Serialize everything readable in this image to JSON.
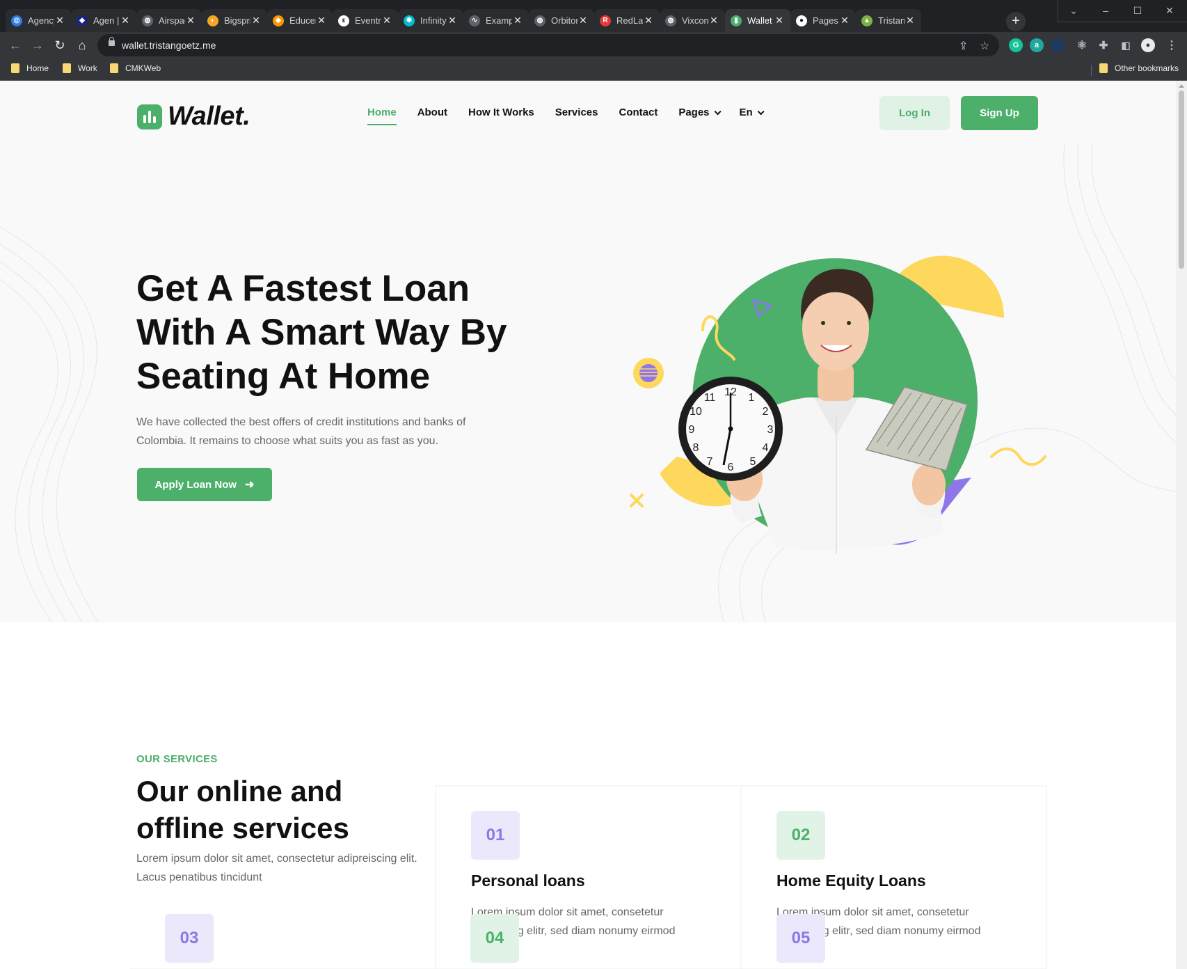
{
  "browser": {
    "tabs": [
      {
        "label": "Agency",
        "color": "#2b7de9",
        "glyph": "◎"
      },
      {
        "label": "Agen |",
        "color": "#1a237e",
        "glyph": "◆"
      },
      {
        "label": "Airspace",
        "color": "#5f6368",
        "glyph": "◍"
      },
      {
        "label": "Bigspring",
        "color": "#f5a623",
        "glyph": "◐"
      },
      {
        "label": "Educenter",
        "color": "#ff9800",
        "glyph": "◆"
      },
      {
        "label": "Eventre",
        "color": "#ffffff",
        "glyph": "ε"
      },
      {
        "label": "Infinity",
        "color": "#00bcd4",
        "glyph": "✱"
      },
      {
        "label": "Example",
        "color": "#5f6368",
        "glyph": "∿"
      },
      {
        "label": "Orbiton",
        "color": "#5f6368",
        "glyph": "◍"
      },
      {
        "label": "RedLab",
        "color": "#e53935",
        "glyph": "R"
      },
      {
        "label": "Vixcon",
        "color": "#5f6368",
        "glyph": "◍"
      },
      {
        "label": "Wallet",
        "color": "#4caf6a",
        "glyph": "▮"
      },
      {
        "label": "Pages",
        "color": "#ffffff",
        "glyph": "●"
      },
      {
        "label": "Tristan",
        "color": "#7cb342",
        "glyph": "▲"
      }
    ],
    "active_tab_index": 11,
    "url": "wallet.tristangoetz.me",
    "bookmarks": [
      "Home",
      "Work",
      "CMKWeb"
    ],
    "other_bookmarks": "Other bookmarks"
  },
  "header": {
    "logo": "Wallet.",
    "nav": [
      {
        "label": "Home",
        "active": true,
        "dropdown": false
      },
      {
        "label": "About",
        "active": false,
        "dropdown": false
      },
      {
        "label": "How It Works",
        "active": false,
        "dropdown": false
      },
      {
        "label": "Services",
        "active": false,
        "dropdown": false
      },
      {
        "label": "Contact",
        "active": false,
        "dropdown": false
      },
      {
        "label": "Pages",
        "active": false,
        "dropdown": true
      },
      {
        "label": "En",
        "active": false,
        "dropdown": true
      }
    ],
    "login_label": "Log In",
    "signup_label": "Sign Up"
  },
  "hero": {
    "title": "Get A Fastest Loan With A Smart Way By Seating At Home",
    "subtitle": "We have collected the best offers of credit institutions and banks of Colombia. It remains to choose what suits you as fast as you.",
    "cta_label": "Apply Loan Now",
    "cta_icon": "arrow-right-icon"
  },
  "services": {
    "eyebrow": "OUR SERVICES",
    "title": "Our online and offline services",
    "description": "Lorem ipsum dolor sit amet, consectetur adipreiscing elit. Lacus penatibus tincidunt",
    "cards": [
      {
        "number": "01",
        "title": "Personal loans",
        "description": "Lorem ipsum dolor sit amet, consetetur sadipscing elitr, sed diam nonumy eirmod",
        "accent": "purple"
      },
      {
        "number": "02",
        "title": "Home Equity Loans",
        "description": "Lorem ipsum dolor sit amet, consetetur sadipscing elitr, sed diam nonumy eirmod",
        "accent": "green"
      },
      {
        "number": "03",
        "title": "",
        "description": "",
        "accent": "purple"
      },
      {
        "number": "04",
        "title": "",
        "description": "",
        "accent": "green"
      },
      {
        "number": "05",
        "title": "",
        "description": "",
        "accent": "purple"
      }
    ]
  },
  "colors": {
    "brand_green": "#4caf6a",
    "accent_purple": "#8b77e6",
    "accent_yellow": "#fdd85d"
  }
}
